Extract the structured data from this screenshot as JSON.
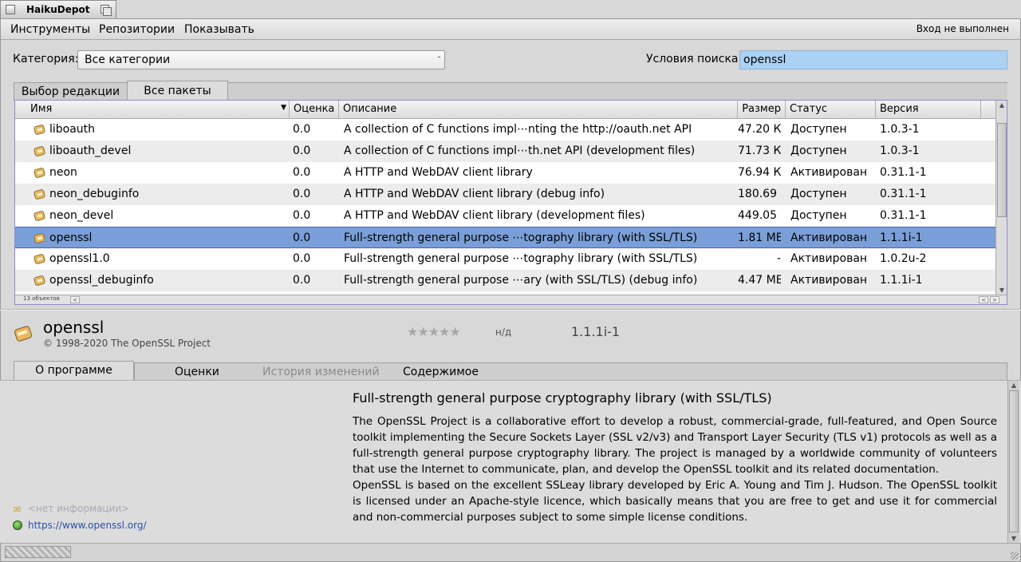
{
  "window": {
    "title": "HaikuDepot"
  },
  "menu": {
    "items": [
      "Инструменты",
      "Репозитории",
      "Показывать"
    ],
    "login_status": "Вход не выполнен"
  },
  "filters": {
    "category_label": "Категория:",
    "category_value": "Все категории",
    "search_label": "Условия поиска:",
    "search_value": "openssl"
  },
  "tabs": {
    "featured": "Выбор редакции",
    "all": "Все пакеты"
  },
  "table": {
    "columns": [
      "Имя",
      "Оценка",
      "Описание",
      "Размер",
      "Статус",
      "Версия"
    ],
    "rows": [
      {
        "name": "liboauth",
        "rating": "0.0",
        "description": "A collection of C functions impl⋯nting the http://oauth.net API",
        "size": "47.20 КБ",
        "status": "Доступен",
        "version": "1.0.3-1",
        "selected": false
      },
      {
        "name": "liboauth_devel",
        "rating": "0.0",
        "description": "A collection of C functions impl⋯th.net API (development files)",
        "size": "71.73 КБ",
        "status": "Доступен",
        "version": "1.0.3-1",
        "selected": false
      },
      {
        "name": "neon",
        "rating": "0.0",
        "description": "A HTTP and WebDAV client library",
        "size": "76.94 КБ",
        "status": "Активирован",
        "version": "0.31.1-1",
        "selected": false
      },
      {
        "name": "neon_debuginfo",
        "rating": "0.0",
        "description": "A HTTP and WebDAV client library (debug info)",
        "size": "180.69 КБ",
        "status": "Доступен",
        "version": "0.31.1-1",
        "selected": false
      },
      {
        "name": "neon_devel",
        "rating": "0.0",
        "description": "A HTTP and WebDAV client library (development files)",
        "size": "449.05 КБ",
        "status": "Доступен",
        "version": "0.31.1-1",
        "selected": false
      },
      {
        "name": "openssl",
        "rating": "0.0",
        "description": "Full-strength general purpose ⋯tography library (with SSL/TLS)",
        "size": "1.81 МБ",
        "status": "Активирован",
        "version": "1.1.1i-1",
        "selected": true
      },
      {
        "name": "openssl1.0",
        "rating": "0.0",
        "description": "Full-strength general purpose ⋯tography library (with SSL/TLS)",
        "size": "-",
        "status": "Активирован",
        "version": "1.0.2u-2",
        "selected": false
      },
      {
        "name": "openssl_debuginfo",
        "rating": "0.0",
        "description": "Full-strength general purpose ⋯ary (with SSL/TLS) (debug info)",
        "size": "4.47 МБ",
        "status": "Активирован",
        "version": "1.1.1i-1",
        "selected": false
      }
    ],
    "item_count": "13 объектов"
  },
  "detail": {
    "title": "openssl",
    "publisher": "© 1998-2020 The OpenSSL Project",
    "stars": "★★★★★",
    "rating_text": "н/д",
    "version": "1.1.1i-1",
    "tabs": {
      "about": "О программе",
      "ratings": "Оценки",
      "changelog": "История изменений",
      "contents": "Содержимое"
    },
    "summary": "Full-strength general purpose cryptography library (with SSL/TLS)",
    "description_p1": "The OpenSSL Project is a collaborative effort to develop a robust, commercial-grade, full-featured, and Open Source toolkit implementing the Secure Sockets Layer (SSL v2/v3) and Transport Layer Security (TLS v1) protocols as well as a full-strength general purpose cryptography library. The project is managed by a worldwide community of volunteers that use the Internet to communicate, plan, and develop the OpenSSL toolkit and its related documentation.",
    "description_p2": "OpenSSL is based on the excellent SSLeay library developed by Eric A. Young and Tim J. Hudson. The OpenSSL toolkit is licensed under an Apache-style licence, which basically means that you are free to get and use it for commercial and non-commercial purposes subject to some simple license conditions.",
    "no_info": "<нет информации>",
    "website": "https://www.openssl.org/"
  },
  "icons": {
    "package": "package-icon",
    "email": "email-icon",
    "website": "globe-icon"
  },
  "colors": {
    "selection": "#7a9fd8",
    "search_bg": "#abd2f4",
    "link": "#2a4ea8"
  }
}
